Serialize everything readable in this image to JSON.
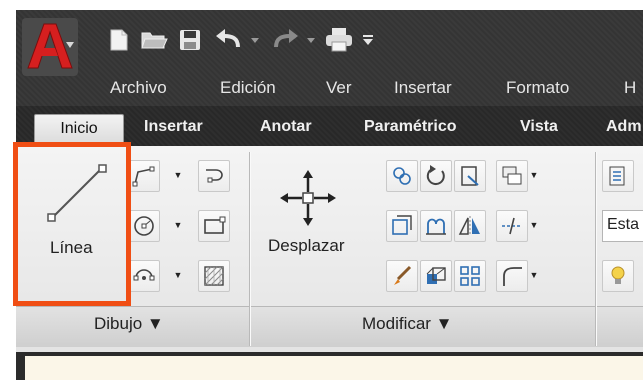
{
  "menu": [
    "Archivo",
    "Edición",
    "Ver",
    "Insertar",
    "Formato",
    "H"
  ],
  "tabs": {
    "active": "Inicio",
    "others": [
      "Insertar",
      "Anotar",
      "Paramétrico",
      "Vista",
      "Adm"
    ]
  },
  "dibujo": {
    "line_label": "Línea",
    "panel_label": "Dibujo ▼"
  },
  "modificar": {
    "move_label": "Desplazar",
    "panel_label": "Modificar ▼"
  },
  "layers": {
    "estado_label": "Esta"
  },
  "colors": {
    "highlight": "#f04e14",
    "accent_red": "#c81e1e"
  }
}
